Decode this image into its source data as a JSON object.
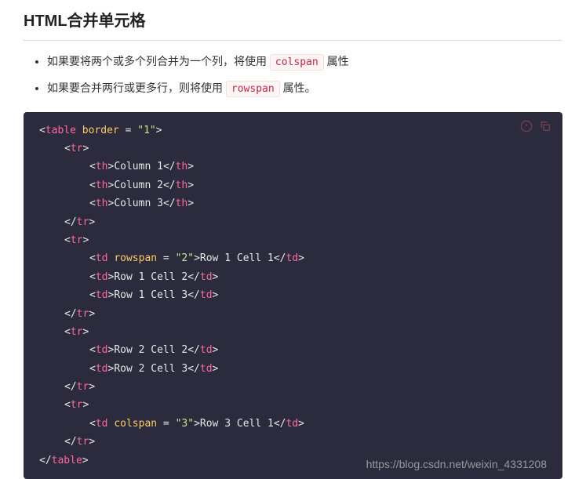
{
  "heading": "HTML合并单元格",
  "bullets": [
    {
      "pre": "如果要将两个或多个列合并为一个列，将使用 ",
      "code": "colspan",
      "post": " 属性"
    },
    {
      "pre": "如果要合并两行或更多行，则将使用 ",
      "code": "rowspan",
      "post": " 属性。"
    }
  ],
  "code": {
    "tags": {
      "table": "table",
      "tr": "tr",
      "th": "th",
      "td": "td"
    },
    "attrs": {
      "border": "border",
      "rowspan": "rowspan",
      "colspan": "colspan"
    },
    "vals": {
      "one": "\"1\"",
      "two": "\"2\"",
      "three": "\"3\""
    },
    "texts": {
      "col1": "Column 1",
      "col2": "Column 2",
      "col3": "Column 3",
      "r1c1": "Row 1 Cell 1",
      "r1c2": "Row 1 Cell 2",
      "r1c3": "Row 1 Cell 3",
      "r2c2": "Row 2 Cell 2",
      "r2c3": "Row 2 Cell 3",
      "r3c1": "Row 3 Cell 1"
    }
  },
  "watermark": "https://blog.csdn.net/weixin_4331208"
}
